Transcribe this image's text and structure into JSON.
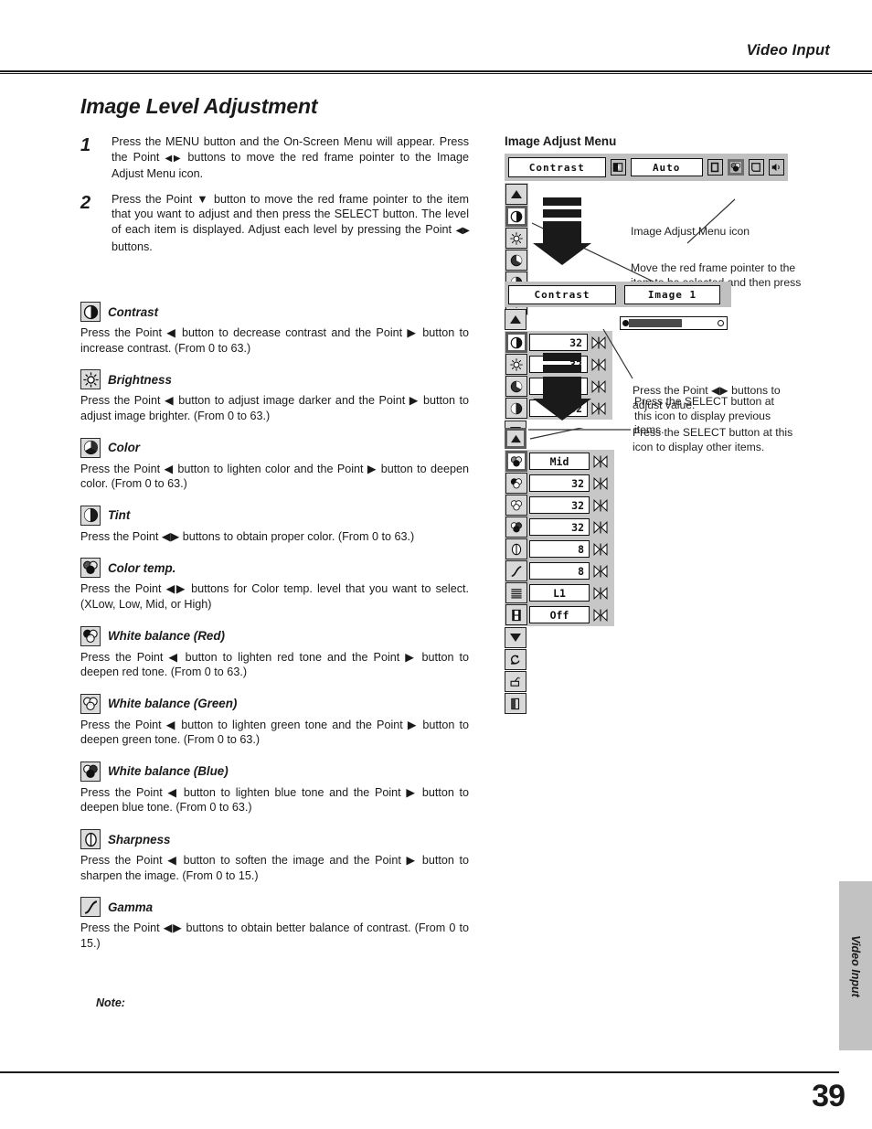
{
  "header": {
    "running_title": "Video Input"
  },
  "page_title": "Image Level Adjustment",
  "steps": [
    {
      "num": "1",
      "text_a": "Press the MENU button and the On-Screen Menu will appear.  Press the Point ",
      "arrows": "◀▶",
      "text_b": " buttons to move the red frame pointer to the Image Adjust Menu icon."
    },
    {
      "num": "2",
      "text_a": "Press the Point ▼ button to move the red frame pointer to the item that you want to adjust and then press the SELECT button.  The level of each item is displayed.  Adjust each level by pressing the Point ",
      "arrows": "◀▶",
      "text_b": " buttons."
    }
  ],
  "items": [
    {
      "icon": "contrast-icon",
      "title": "Contrast",
      "desc": "Press the Point ◀ button to decrease contrast and the Point ▶ button to increase contrast.  (From 0 to 63.)"
    },
    {
      "icon": "brightness-icon",
      "title": "Brightness",
      "desc": "Press the Point ◀ button to adjust image darker and the Point ▶ button to adjust image brighter.  (From 0 to 63.)"
    },
    {
      "icon": "color-icon",
      "title": "Color",
      "desc": "Press the Point ◀ button to lighten color and the Point ▶ button to deepen color.  (From 0 to 63.)"
    },
    {
      "icon": "tint-icon",
      "title": "Tint",
      "desc": "Press the Point ◀▶ buttons to obtain proper color.  (From 0 to 63.)"
    },
    {
      "icon": "color-temp-icon",
      "title": "Color temp.",
      "desc": "Press the Point ◀▶ buttons for Color temp. level that you want to select. (XLow, Low, Mid, or High)"
    },
    {
      "icon": "white-balance-red-icon",
      "title": "White balance (Red)",
      "desc": "Press the Point ◀ button to lighten red tone and the Point ▶ button to deepen red tone.  (From 0 to 63.)"
    },
    {
      "icon": "white-balance-green-icon",
      "title": "White balance (Green)",
      "desc": "Press the Point ◀ button to lighten green tone and the Point ▶ button to deepen green tone.  (From 0 to 63.)"
    },
    {
      "icon": "white-balance-blue-icon",
      "title": "White balance (Blue)",
      "desc": "Press the Point ◀ button to lighten blue tone and the Point ▶ button to deepen blue tone.  (From 0 to 63.)"
    },
    {
      "icon": "sharpness-icon",
      "title": "Sharpness",
      "desc": "Press the Point ◀ button to soften the image and the Point ▶ button to sharpen the image.  (From 0 to 15.)"
    },
    {
      "icon": "gamma-icon",
      "title": "Gamma",
      "desc": "Press the Point ◀▶ buttons to obtain better balance of contrast. (From 0 to 15.)"
    }
  ],
  "note_label": "Note:",
  "osd": {
    "caption": "Image Adjust Menu",
    "menu1": {
      "title_field": "Contrast",
      "auto_field": "Auto",
      "toolbar_icons": [
        "input-icon",
        "screen-icon",
        "image-adjust-icon",
        "pc-adjust-icon",
        "sound-icon"
      ],
      "selected_toolbar_icon": "image-adjust-icon",
      "side_icons": [
        "up-arrow-icon",
        "contrast-icon",
        "brightness-icon",
        "color-icon",
        "tint-icon",
        "down-arrow-icon"
      ],
      "selected_side_icon": "contrast-icon",
      "callout_menu_icon": "Image Adjust Menu icon",
      "callout_pointer": "Move the red frame pointer to the item to be selected and then press the SELECT button."
    },
    "menu2": {
      "title_field": "Contrast",
      "image_field": "Image 1",
      "rows": [
        {
          "icon": "contrast-icon",
          "value": "32",
          "selected": true
        },
        {
          "icon": "brightness-icon",
          "value": "32",
          "selected": false
        },
        {
          "icon": "color-icon",
          "value": "32",
          "selected": false
        },
        {
          "icon": "tint-icon",
          "value": "32",
          "selected": false
        }
      ],
      "slider_percent": 52,
      "callout_adjust": "Press the Point ◀▶ buttons to adjust value.",
      "callout_other": "Press the SELECT button at this icon to display other items.",
      "top_icon": "up-arrow-icon",
      "bottom_icon": "down-arrow-icon"
    },
    "menu3": {
      "top_icon": "up-arrow-icon",
      "rows": [
        {
          "icon": "color-temp-icon",
          "value": "Mid",
          "selected": true
        },
        {
          "icon": "white-balance-red-icon",
          "value": "32",
          "selected": false
        },
        {
          "icon": "white-balance-green-icon",
          "value": "32",
          "selected": false
        },
        {
          "icon": "white-balance-blue-icon",
          "value": "32",
          "selected": false
        },
        {
          "icon": "sharpness-icon",
          "value": "8",
          "selected": false
        },
        {
          "icon": "gamma-icon",
          "value": "8",
          "selected": false
        },
        {
          "icon": "progressive-icon",
          "value": "L1",
          "selected": false
        },
        {
          "icon": "film-icon",
          "value": "Off",
          "selected": false
        }
      ],
      "footer_icons": [
        "down-arrow-icon",
        "reset-icon",
        "store-icon",
        "quit-icon"
      ],
      "callout_previous": "Press the SELECT button at this icon to display previous items."
    }
  },
  "side_tab": "Video Input",
  "page_number": "39"
}
